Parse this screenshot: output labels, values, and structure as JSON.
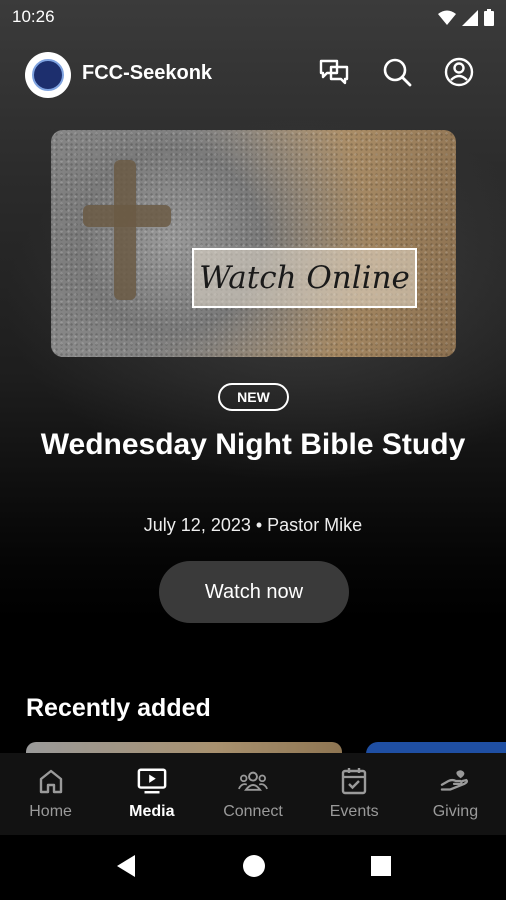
{
  "status_bar": {
    "time": "10:26",
    "icons": [
      "wifi-icon",
      "signal-icon",
      "battery-icon"
    ]
  },
  "header": {
    "app_name": "FCC-Seekonk",
    "actions": [
      "chat-icon",
      "search-icon",
      "account-icon"
    ]
  },
  "featured": {
    "image_text": "Watch Online",
    "badge": "NEW",
    "title": "Wednesday Night Bible Study",
    "meta": "July 12, 2023 • Pastor Mike",
    "button_label": "Watch now"
  },
  "recently_added": {
    "title": "Recently added"
  },
  "bottom_nav": {
    "items": [
      {
        "label": "Home",
        "icon": "home-icon",
        "active": false
      },
      {
        "label": "Media",
        "icon": "media-icon",
        "active": true
      },
      {
        "label": "Connect",
        "icon": "connect-icon",
        "active": false
      },
      {
        "label": "Events",
        "icon": "calendar-icon",
        "active": false
      },
      {
        "label": "Giving",
        "icon": "giving-icon",
        "active": false
      }
    ]
  },
  "system_nav": [
    "back-icon",
    "home-circle-icon",
    "recents-icon"
  ],
  "colors": {
    "background": "#000000",
    "button": "#3a3a3a",
    "nav_bar": "#121212",
    "accent_blue": "#1f4fa3"
  }
}
